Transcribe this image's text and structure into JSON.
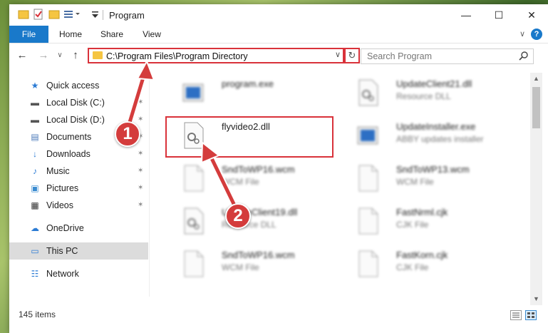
{
  "window": {
    "title": "Program",
    "minimize": "—",
    "maximize": "☐",
    "close": "✕"
  },
  "ribbon": {
    "tabs": [
      "File",
      "Home",
      "Share",
      "View"
    ],
    "expand_glyph": "∨",
    "help_glyph": "?"
  },
  "nav": {
    "back": "←",
    "forward": "→",
    "recent": "∨",
    "up": "↑",
    "address": "C:\\Program Files\\Program Directory",
    "address_dropdown": "∨",
    "refresh": "↻",
    "search_placeholder": "Search Program",
    "search_icon": "⌕"
  },
  "sidebar": {
    "items": [
      {
        "label": "Quick access",
        "icon": "star-icon",
        "glyph": "★",
        "color": "#2b7bd4",
        "pinned": false
      },
      {
        "label": "Local Disk (C:)",
        "icon": "drive-icon",
        "glyph": "▬",
        "color": "#555555",
        "pinned": true
      },
      {
        "label": "Local Disk (D:)",
        "icon": "drive-icon",
        "glyph": "▬",
        "color": "#555555",
        "pinned": true
      },
      {
        "label": "Documents",
        "icon": "documents-icon",
        "glyph": "▤",
        "color": "#4a78b8",
        "pinned": true
      },
      {
        "label": "Downloads",
        "icon": "downloads-icon",
        "glyph": "↓",
        "color": "#2b7bd4",
        "pinned": true
      },
      {
        "label": "Music",
        "icon": "music-icon",
        "glyph": "♪",
        "color": "#2b7bd4",
        "pinned": true
      },
      {
        "label": "Pictures",
        "icon": "pictures-icon",
        "glyph": "▣",
        "color": "#3a8bd0",
        "pinned": true
      },
      {
        "label": "Videos",
        "icon": "videos-icon",
        "glyph": "▦",
        "color": "#333333",
        "pinned": true
      },
      {
        "label": "OneDrive",
        "icon": "cloud-icon",
        "glyph": "☁",
        "color": "#2b7bd4",
        "pinned": false
      },
      {
        "label": "This PC",
        "icon": "computer-icon",
        "glyph": "▭",
        "color": "#2b7bd4",
        "pinned": false
      },
      {
        "label": "Network",
        "icon": "network-icon",
        "glyph": "☷",
        "color": "#2b7bd4",
        "pinned": false
      }
    ],
    "pin_glyph": "✶"
  },
  "files": [
    {
      "name": "program.exe",
      "desc": "",
      "icon": "exe-icon"
    },
    {
      "name": "UpdateClient21.dll",
      "desc": "Resource DLL",
      "icon": "dll-icon"
    },
    {
      "name": "flyvideo2.dll",
      "desc": "",
      "icon": "dll-icon"
    },
    {
      "name": "UpdateInstaller.exe",
      "desc": "ABBY updates installer",
      "icon": "exe-icon"
    },
    {
      "name": "SndToWP16.wcm",
      "desc": "WCM File",
      "icon": "file-icon"
    },
    {
      "name": "SndToWP13.wcm",
      "desc": "WCM File",
      "icon": "file-icon"
    },
    {
      "name": "UpdateClient19.dll",
      "desc": "Resource DLL",
      "icon": "dll-icon"
    },
    {
      "name": "FastNrml.cjk",
      "desc": "CJK File",
      "icon": "file-icon"
    },
    {
      "name": "SndToWP16.wcm",
      "desc": "WCM File",
      "icon": "file-icon"
    },
    {
      "name": "FastKorn.cjk",
      "desc": "CJK File",
      "icon": "file-icon"
    }
  ],
  "status": {
    "items": "145 items"
  },
  "callouts": [
    "1",
    "2"
  ],
  "colors": {
    "accent": "#1979ca",
    "highlight": "#d9323a",
    "badge": "#d43c3c"
  }
}
